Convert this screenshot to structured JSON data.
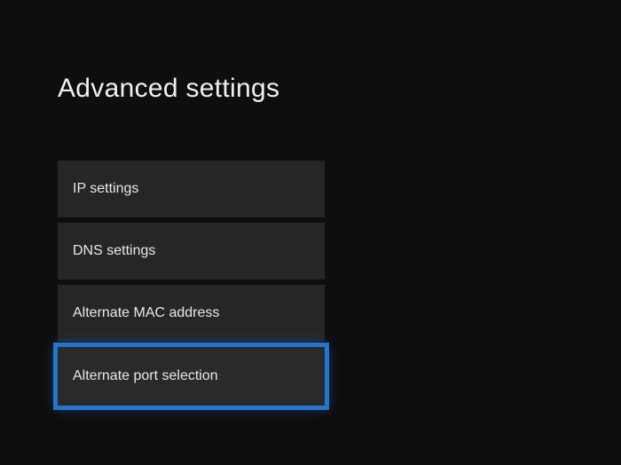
{
  "title": "Advanced settings",
  "menu": {
    "items": [
      {
        "label": "IP settings",
        "highlighted": false
      },
      {
        "label": "DNS settings",
        "highlighted": false
      },
      {
        "label": "Alternate MAC address",
        "highlighted": false
      },
      {
        "label": "Alternate port selection",
        "highlighted": true
      }
    ]
  }
}
